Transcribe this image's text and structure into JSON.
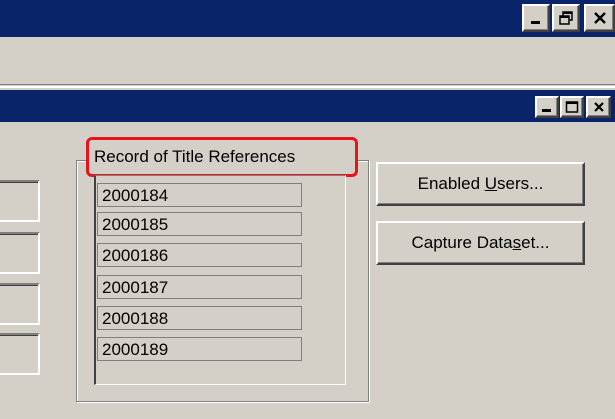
{
  "outer_window": {
    "caption_buttons": [
      {
        "name": "minimize-icon"
      },
      {
        "name": "restore-icon"
      },
      {
        "name": "close-icon"
      }
    ]
  },
  "inner_window": {
    "caption_buttons": [
      {
        "name": "minimize-icon"
      },
      {
        "name": "maximize-icon"
      },
      {
        "name": "close-icon"
      }
    ]
  },
  "group": {
    "title": "Record of Title References",
    "highlight_color": "#e8141b",
    "items": [
      "2000184",
      "2000185",
      "2000186",
      "2000187",
      "2000188",
      "2000189"
    ]
  },
  "buttons": {
    "enabled_users": {
      "before": "Enabled ",
      "mnemonic": "U",
      "after": "sers..."
    },
    "capture_dataset": {
      "before": "Capture Data",
      "mnemonic": "s",
      "after": "et..."
    }
  },
  "colors": {
    "titlebar": "#0a246a",
    "face": "#d4d0c8"
  }
}
